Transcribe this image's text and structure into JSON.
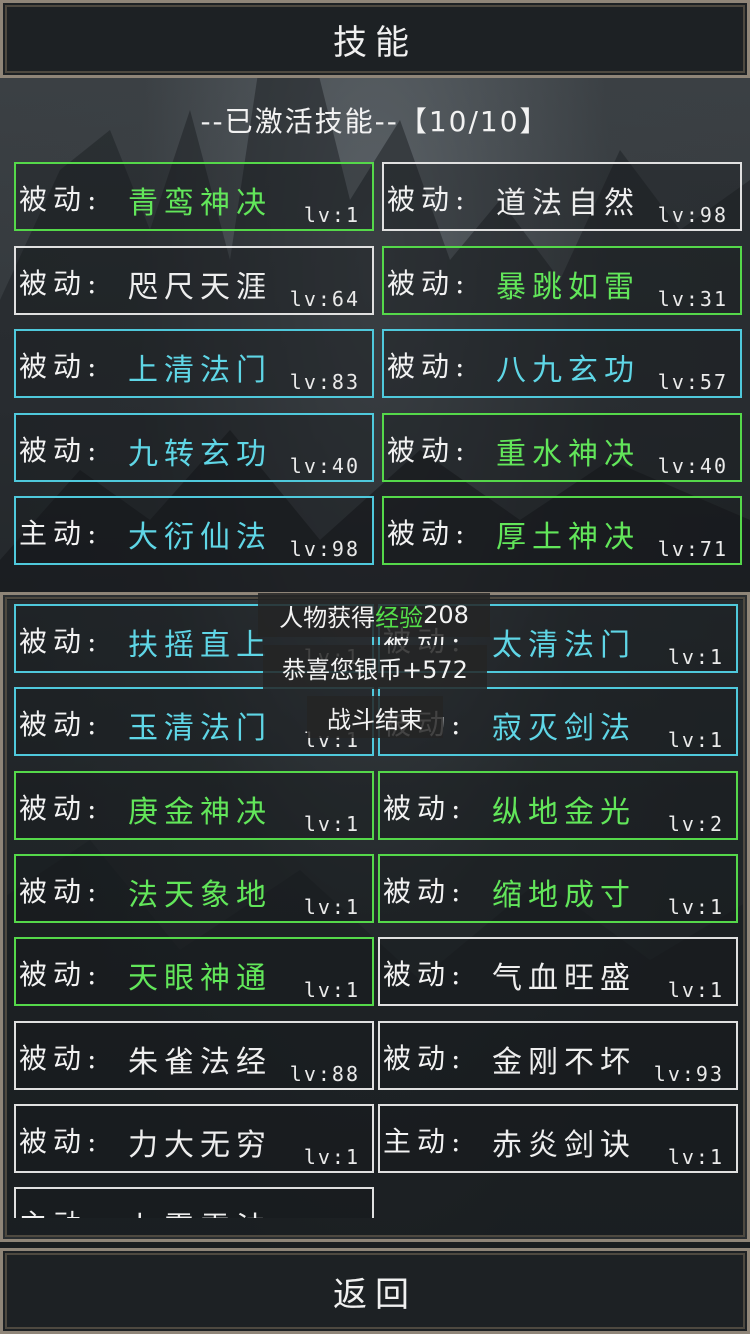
{
  "title": "技能",
  "active_section": {
    "label": "--已激活技能--",
    "count": "【10/10】"
  },
  "active_skills": [
    {
      "type": "被动:",
      "name": "青鸾神决",
      "lv": "lv:1",
      "border": "green",
      "color": "green"
    },
    {
      "type": "被动:",
      "name": "道法自然",
      "lv": "lv:98",
      "border": "white",
      "color": "white"
    },
    {
      "type": "被动:",
      "name": "咫尺天涯",
      "lv": "lv:64",
      "border": "white",
      "color": "white"
    },
    {
      "type": "被动:",
      "name": "暴跳如雷",
      "lv": "lv:31",
      "border": "green",
      "color": "green"
    },
    {
      "type": "被动:",
      "name": "上清法门",
      "lv": "lv:83",
      "border": "cyan",
      "color": "cyan"
    },
    {
      "type": "被动:",
      "name": "八九玄功",
      "lv": "lv:57",
      "border": "cyan",
      "color": "cyan"
    },
    {
      "type": "被动:",
      "name": "九转玄功",
      "lv": "lv:40",
      "border": "cyan",
      "color": "cyan"
    },
    {
      "type": "被动:",
      "name": "重水神决",
      "lv": "lv:40",
      "border": "green",
      "color": "green"
    },
    {
      "type": "主动:",
      "name": "大衍仙法",
      "lv": "lv:98",
      "border": "cyan",
      "color": "cyan"
    },
    {
      "type": "被动:",
      "name": "厚土神决",
      "lv": "lv:71",
      "border": "green",
      "color": "green"
    }
  ],
  "inactive_skills": [
    {
      "type": "被动:",
      "name": "扶摇直上",
      "lv": "lv:1",
      "border": "cyan",
      "color": "cyan"
    },
    {
      "type": "被动:",
      "name": "太清法门",
      "lv": "lv:1",
      "border": "cyan",
      "color": "cyan"
    },
    {
      "type": "被动:",
      "name": "玉清法门",
      "lv": "lv:1",
      "border": "cyan",
      "color": "cyan"
    },
    {
      "type": "被动:",
      "name": "寂灭剑法",
      "lv": "lv:1",
      "border": "cyan",
      "color": "cyan"
    },
    {
      "type": "被动:",
      "name": "庚金神决",
      "lv": "lv:1",
      "border": "green",
      "color": "green"
    },
    {
      "type": "被动:",
      "name": "纵地金光",
      "lv": "lv:2",
      "border": "green",
      "color": "green"
    },
    {
      "type": "被动:",
      "name": "法天象地",
      "lv": "lv:1",
      "border": "green",
      "color": "green"
    },
    {
      "type": "被动:",
      "name": "缩地成寸",
      "lv": "lv:1",
      "border": "green",
      "color": "green"
    },
    {
      "type": "被动:",
      "name": "天眼神通",
      "lv": "lv:1",
      "border": "green",
      "color": "green"
    },
    {
      "type": "被动:",
      "name": "气血旺盛",
      "lv": "lv:1",
      "border": "white",
      "color": "white"
    },
    {
      "type": "被动:",
      "name": "朱雀法经",
      "lv": "lv:88",
      "border": "white",
      "color": "white"
    },
    {
      "type": "被动:",
      "name": "金刚不坏",
      "lv": "lv:93",
      "border": "white",
      "color": "white"
    },
    {
      "type": "被动:",
      "name": "力大无穷",
      "lv": "lv:1",
      "border": "white",
      "color": "white"
    },
    {
      "type": "主动:",
      "name": "赤炎剑诀",
      "lv": "lv:1",
      "border": "white",
      "color": "white"
    },
    {
      "type": "主动:",
      "name": "九霄雷法",
      "lv": "",
      "border": "white",
      "color": "white"
    }
  ],
  "toasts": {
    "exp_prefix": "人物获得",
    "exp_label": "经验",
    "exp_value": "208",
    "coins": "恭喜您银币+572",
    "battle_end": "战斗结束"
  },
  "back_label": "返回",
  "colors": {
    "white": "#e0e0e0",
    "cyan": "#4fc9dc",
    "green": "#55d84a",
    "frame": "#8f8578"
  }
}
